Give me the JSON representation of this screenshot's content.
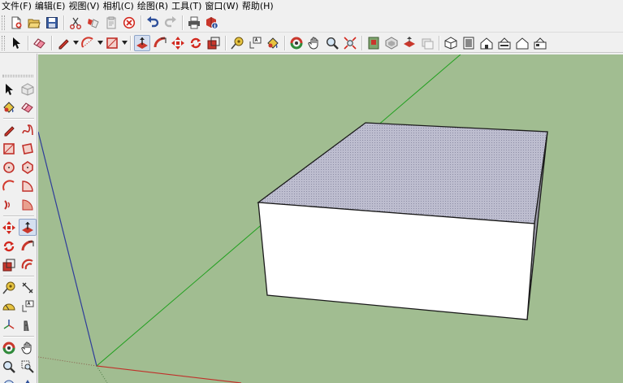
{
  "app": {
    "menu": [
      {
        "id": "file",
        "label": "文件(F)"
      },
      {
        "id": "edit",
        "label": "编辑(E)"
      },
      {
        "id": "view",
        "label": "视图(V)"
      },
      {
        "id": "camera",
        "label": "相机(C)"
      },
      {
        "id": "draw",
        "label": "绘图(R)"
      },
      {
        "id": "tools",
        "label": "工具(T)"
      },
      {
        "id": "window",
        "label": "窗口(W)"
      },
      {
        "id": "help",
        "label": "帮助(H)"
      }
    ]
  },
  "colors": {
    "viewport_background": "#a1bd91",
    "box_top_face": "#b7b7c9",
    "box_front_face": "#ffffff",
    "box_side_face": "#9c9ca8",
    "axis_red": "#c0302a",
    "axis_green": "#22a020",
    "axis_blue": "#2f3d9a",
    "accent_tool_active": "#d5dff0"
  },
  "toolbars": {
    "standard": [
      "new-icon",
      "open-icon",
      "save-icon",
      "cut-icon",
      "copy-icon",
      "paste-icon",
      "erase-icon",
      "undo-icon",
      "redo-icon",
      "print-icon",
      "model-info-icon"
    ],
    "tools": [
      "select-icon",
      "make-component-icon",
      "eraser-icon",
      "pencil-icon",
      "arc-icon",
      "rectangle-icon",
      "push-pull-icon",
      "follow-me-icon",
      "move-icon",
      "rotate-icon",
      "scale-icon",
      "tape-measure-icon",
      "text-icon",
      "paint-bucket-icon",
      "orbit-icon",
      "pan-icon",
      "zoom-icon",
      "zoom-extents-icon",
      "previous-view-icon",
      "get-models-icon",
      "share-model-icon",
      "iso-view-icon",
      "top-view-icon",
      "front-view-icon",
      "right-view-icon",
      "back-view-icon",
      "left-view-icon"
    ]
  },
  "palette": [
    "select-icon",
    "make-component-icon",
    "paint-bucket-icon",
    "eraser-icon",
    "line-icon",
    "freehand-icon",
    "rectangle-icon",
    "rotated-rectangle-icon",
    "circle-icon",
    "polygon-icon",
    "arc-icon",
    "pie-icon",
    "three-point-arc-icon",
    "two-point-arc-icon",
    "move-icon",
    "push-pull-icon",
    "rotate-icon",
    "follow-me-icon",
    "scale-icon",
    "offset-icon",
    "tape-measure-icon",
    "dimension-icon",
    "protractor-icon",
    "text-icon",
    "axes-icon",
    "3d-text-icon",
    "orbit-icon",
    "pan-icon",
    "zoom-icon",
    "zoom-window-icon"
  ]
}
